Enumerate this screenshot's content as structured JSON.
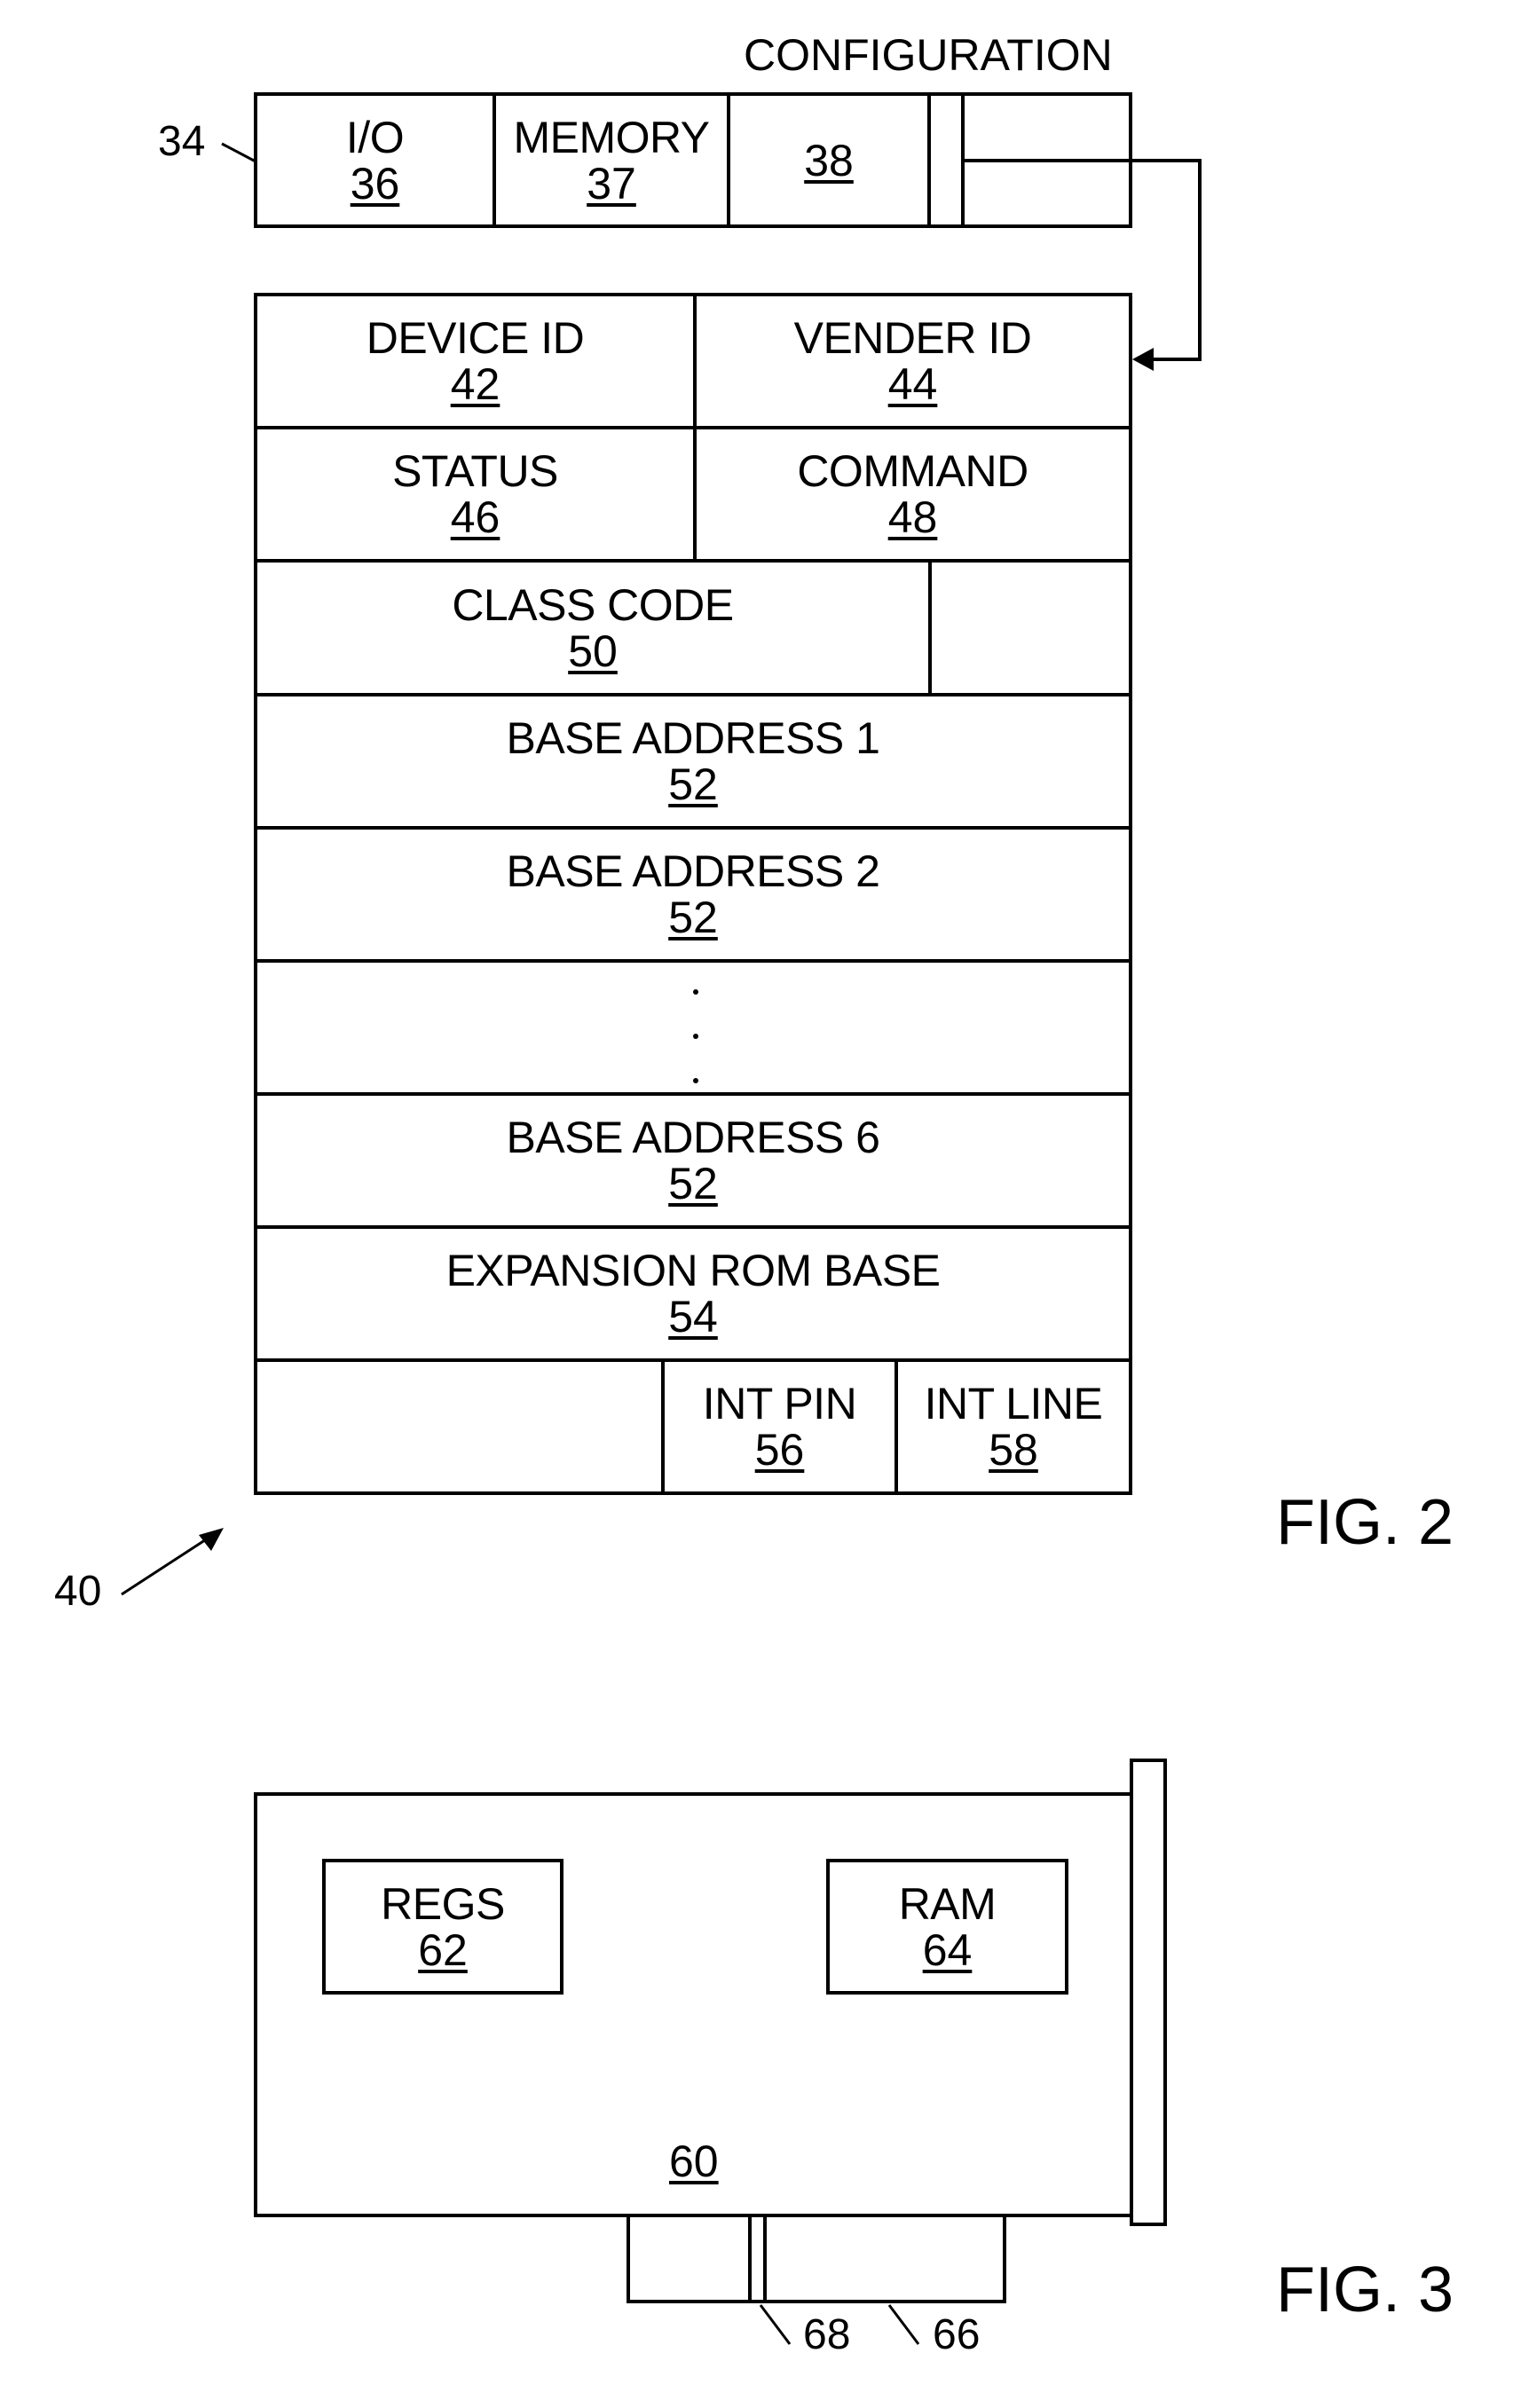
{
  "fig2": {
    "caption": "FIG. 2",
    "ref_label": "40",
    "config_header": {
      "ref_label": "34",
      "title": "CONFIGURATION",
      "fields": [
        {
          "label": "I/O",
          "ref": "36"
        },
        {
          "label": "MEMORY",
          "ref": "37"
        },
        {
          "label": "",
          "ref": "38"
        }
      ]
    },
    "registers": {
      "device_id": {
        "label": "DEVICE ID",
        "ref": "42"
      },
      "vender_id": {
        "label": "VENDER ID",
        "ref": "44"
      },
      "status": {
        "label": "STATUS",
        "ref": "46"
      },
      "command": {
        "label": "COMMAND",
        "ref": "48"
      },
      "class_code": {
        "label": "CLASS CODE",
        "ref": "50"
      },
      "base_address_1": {
        "label": "BASE ADDRESS 1",
        "ref": "52"
      },
      "base_address_2": {
        "label": "BASE ADDRESS 2",
        "ref": "52"
      },
      "base_address_6": {
        "label": "BASE ADDRESS 6",
        "ref": "52"
      },
      "expansion_rom": {
        "label": "EXPANSION ROM BASE",
        "ref": "54"
      },
      "int_pin": {
        "label": "INT PIN",
        "ref": "56"
      },
      "int_line": {
        "label": "INT LINE",
        "ref": "58"
      }
    }
  },
  "fig3": {
    "caption": "FIG. 3",
    "card_ref": "60",
    "regs": {
      "label": "REGS",
      "ref": "62"
    },
    "ram": {
      "label": "RAM",
      "ref": "64"
    },
    "connector_ref": "66",
    "notch_ref": "68"
  }
}
